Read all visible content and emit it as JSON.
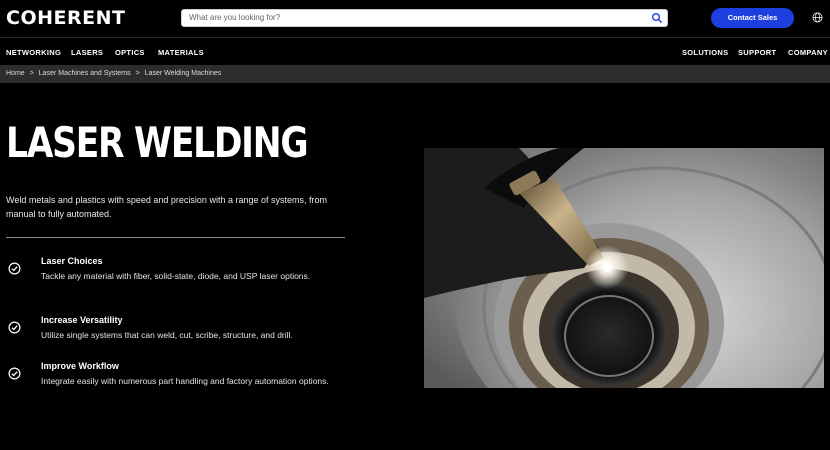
{
  "brand": {
    "name": "COHERENT"
  },
  "search": {
    "placeholder": "What are you looking for?"
  },
  "header": {
    "contact_label": "Contact Sales"
  },
  "nav_left": [
    "NETWORKING",
    "LASERS",
    "OPTICS",
    "MATERIALS"
  ],
  "nav_right": [
    "SOLUTIONS",
    "SUPPORT",
    "COMPANY"
  ],
  "breadcrumb": [
    "Home",
    "Laser Machines and Systems",
    "Laser Welding Machines"
  ],
  "breadcrumb_sep": ">",
  "hero": {
    "title": "LASER WELDING",
    "description": "Weld metals and plastics with speed and precision with a range of systems, from manual to fully automated."
  },
  "features": [
    {
      "title": "Laser Choices",
      "text": "Tackle any material with fiber, solid-state, diode, and USP laser options."
    },
    {
      "title": "Increase Versatility",
      "text": "Utilize single systems that can weld, cut, scribe, structure, and drill."
    },
    {
      "title": "Improve Workflow",
      "text": "Integrate easily with numerous part handling and factory automation options."
    }
  ],
  "colors": {
    "accent": "#1d3fe0",
    "background": "#000000",
    "breadcrumb_bg": "#2d2d2d"
  },
  "icons": {
    "search": "search-icon",
    "globe": "globe-icon",
    "check": "check-circle-icon"
  }
}
